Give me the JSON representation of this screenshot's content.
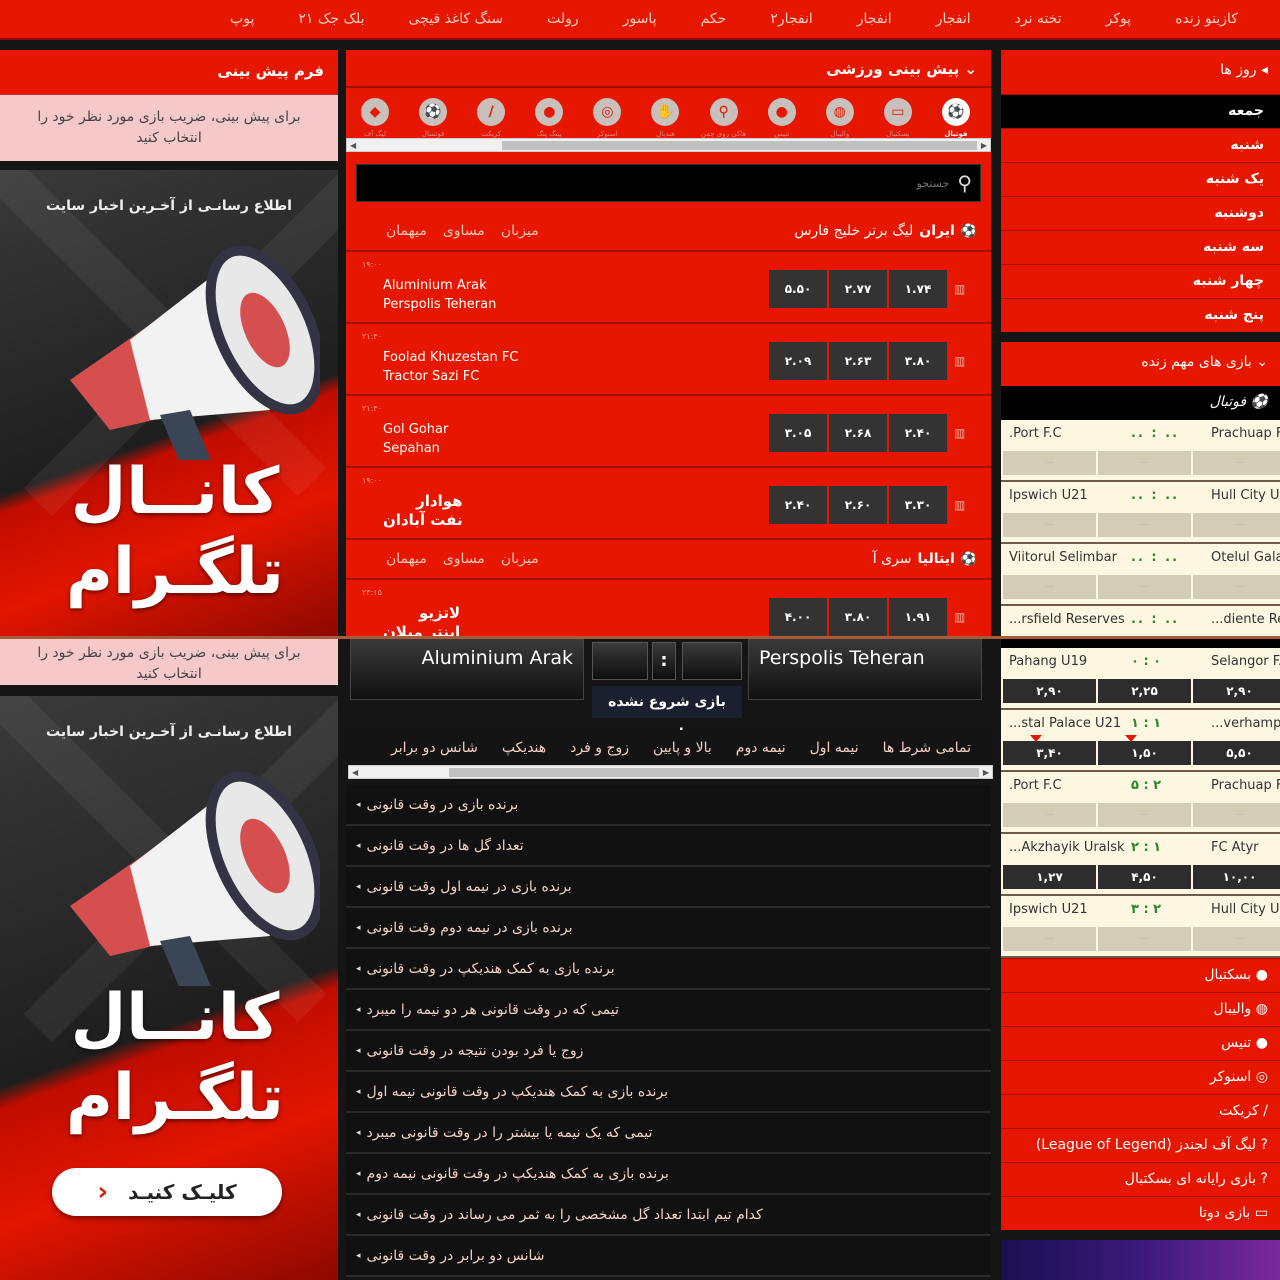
{
  "nav": {
    "items": [
      "کازینو زنده",
      "پوکر",
      "تخته نرد",
      "انفجار",
      "انفجار",
      "انفجار۲",
      "حکم",
      "پاسور",
      "رولت",
      "سنگ کاغذ قیچی",
      "بلک جک ۲۱",
      "پوپ"
    ]
  },
  "left": {
    "form_title": "فرم پیش بینی",
    "form_hint": "برای پیش بینی، ضریب بازی مورد نظر خود را انتخاب کنید",
    "ad": {
      "notify": "اطلاع رسانـی از آخـرین اخبار سایت",
      "line1": "کانــال",
      "line2": "تلگـرام",
      "button": "کلیـک کنیـد"
    }
  },
  "center": {
    "section_title": "پیش بینی ورزشی",
    "sports": [
      {
        "label": "فوتبال",
        "icon": "soccer-icon",
        "active": true
      },
      {
        "label": "بسکتبال",
        "icon": "basketball-icon"
      },
      {
        "label": "والیبال",
        "icon": "volleyball-icon"
      },
      {
        "label": "تنیس",
        "icon": "tennis-icon"
      },
      {
        "label": "هاکی روی چمن",
        "icon": "hockey-icon"
      },
      {
        "label": "هندبال",
        "icon": "handball-icon"
      },
      {
        "label": "اسنوکر",
        "icon": "snooker-icon"
      },
      {
        "label": "پینگ پنگ",
        "icon": "table-tennis-icon"
      },
      {
        "label": "کریکت",
        "icon": "cricket-icon"
      },
      {
        "label": "فوتسال",
        "icon": "futsal-icon"
      },
      {
        "label": "لیگ آف",
        "icon": "esports-icon"
      }
    ],
    "search_placeholder": "جستجو",
    "col_headers": {
      "home": "میزبان",
      "draw": "مساوی",
      "away": "میهمان"
    },
    "leagues": [
      {
        "name_prefix": "لیگ برتر خلیج فارس",
        "name_main": "ایران",
        "matches": [
          {
            "time": "۱۹:۰۰",
            "home": "Aluminium Arak",
            "away": "Perspolis Teheran",
            "odds": [
              "۵.۵۰",
              "۲.۷۷",
              "۱.۷۴"
            ]
          },
          {
            "time": "۲۱:۳۰",
            "home": "Foolad Khuzestan FC",
            "away": "Tractor Sazi FC",
            "odds": [
              "۲.۰۹",
              "۲.۶۳",
              "۳.۸۰"
            ]
          },
          {
            "time": "۲۱:۳۰",
            "home": "Gol Gohar",
            "away": "Sepahan",
            "odds": [
              "۳.۰۵",
              "۲.۶۸",
              "۲.۴۰"
            ]
          },
          {
            "time": "۱۹:۰۰",
            "home": "هوادار",
            "away": "نفت آبادان",
            "odds": [
              "۲.۴۰",
              "۲.۶۰",
              "۳.۳۰"
            ]
          }
        ]
      },
      {
        "name_prefix": "سری آ",
        "name_main": "ایتالیا",
        "matches": [
          {
            "time": "۲۳:۱۵",
            "home": "لاتزیو",
            "away": "اینتر میلان",
            "odds": [
              "۴.۰۰",
              "۳.۸۰",
              "۱.۹۱"
            ]
          }
        ]
      }
    ]
  },
  "detail": {
    "home": "Aluminium Arak",
    "away": "Perspolis Teheran",
    "separator": ":",
    "status": "بازی شروع نشده است",
    "tabs": [
      "تمامی شرط ها",
      "نیمه اول",
      "نیمه دوم",
      "بالا و پایین",
      "زوج و فرد",
      "هندیکپ",
      "شانس دو برابر"
    ],
    "markets": [
      "برنده بازی در وقت قانونی",
      "تعداد گل ها در وقت قانونی",
      "برنده بازی در نیمه اول وقت قانونی",
      "برنده بازی در نیمه دوم وقت قانونی",
      "برنده بازی به کمک هندیکپ در وقت قانونی",
      "تیمی که در وقت قانونی هر دو نیمه را میبرد",
      "زوج یا فرد بودن نتیجه در وقت قانونی",
      "برنده بازی به کمک هندیکپ در وقت قانونی نیمه اول",
      "تیمی که یک نیمه یا بیشتر را در وقت قانونی میبرد",
      "برنده بازی به کمک هندیکپ در وقت قانونی نیمه دوم",
      "کدام تیم ابتدا تعداد گل مشخصی را به ثمر می رساند در وقت قانونی",
      "شانس دو برابر در وقت قانونی"
    ]
  },
  "right": {
    "days_title": "روز ها",
    "days": [
      "جمعه",
      "شنبه",
      "یک شنبه",
      "دوشنبه",
      "سه شنبه",
      "چهار شنبه",
      "پنج شنبه"
    ],
    "active_day": "جمعه",
    "live_title": "بازی های مهم زنده",
    "football_label": "فوتبال",
    "live_top": [
      {
        "home": ".Port F.C",
        "score": ".. : ..",
        "away": "Prachuap F",
        "odds": [
          "—",
          "—",
          "—"
        ]
      },
      {
        "home": "Ipswich U21",
        "score": ".. : ..",
        "away": "Hull City U",
        "odds": [
          "—",
          "—",
          "—"
        ]
      },
      {
        "home": "Viitorul Selimbar",
        "score": ".. : ..",
        "away": "Otelul Gala",
        "odds": [
          "—",
          "—",
          "—"
        ]
      },
      {
        "home": "...rsfield Reserves",
        "score": ".. : ..",
        "away": "...diente Reserve"
      }
    ],
    "live_bottom": [
      {
        "home": "Pahang U19",
        "score": "۰ : ۰",
        "away": "Selangor FA U",
        "odds": [
          "۲,۹۰",
          "۲,۲۵",
          "۲,۹۰"
        ],
        "dark": true
      },
      {
        "home": "...stal Palace U21",
        "score": "۱ : ۱",
        "away": "...verhampton U",
        "odds": [
          "۳,۴۰",
          "۱,۵۰",
          "۵,۵۰"
        ],
        "dark": true,
        "down": [
          0,
          1
        ]
      },
      {
        "home": ".Port F.C",
        "score": "۵ : ۲",
        "away": "Prachuap F",
        "odds": [
          "—",
          "—",
          "—"
        ]
      },
      {
        "home": "...Akzhayik Uralsk",
        "score": "۲ : ۱",
        "away": "FC Atyr",
        "odds": [
          "۱,۲۷",
          "۴,۵۰",
          "۱۰,۰۰"
        ],
        "dark": true
      },
      {
        "home": "Ipswich U21",
        "score": "۳ : ۲",
        "away": "Hull City U",
        "odds": [
          "—",
          "—",
          "—"
        ]
      }
    ],
    "other_sports": [
      "بسکتبال",
      "والیبال",
      "تنیس",
      "اسنوکر",
      "کریکت",
      "لیگ آف لجندز (League of Legend)",
      "بازی رایانه ای بسکتبال",
      "بازی دوتا"
    ]
  },
  "colors": {
    "brand_red": "#e61600",
    "dark": "#151515",
    "pink_panel": "#f5c9c9",
    "cream": "#fdf6e0"
  }
}
